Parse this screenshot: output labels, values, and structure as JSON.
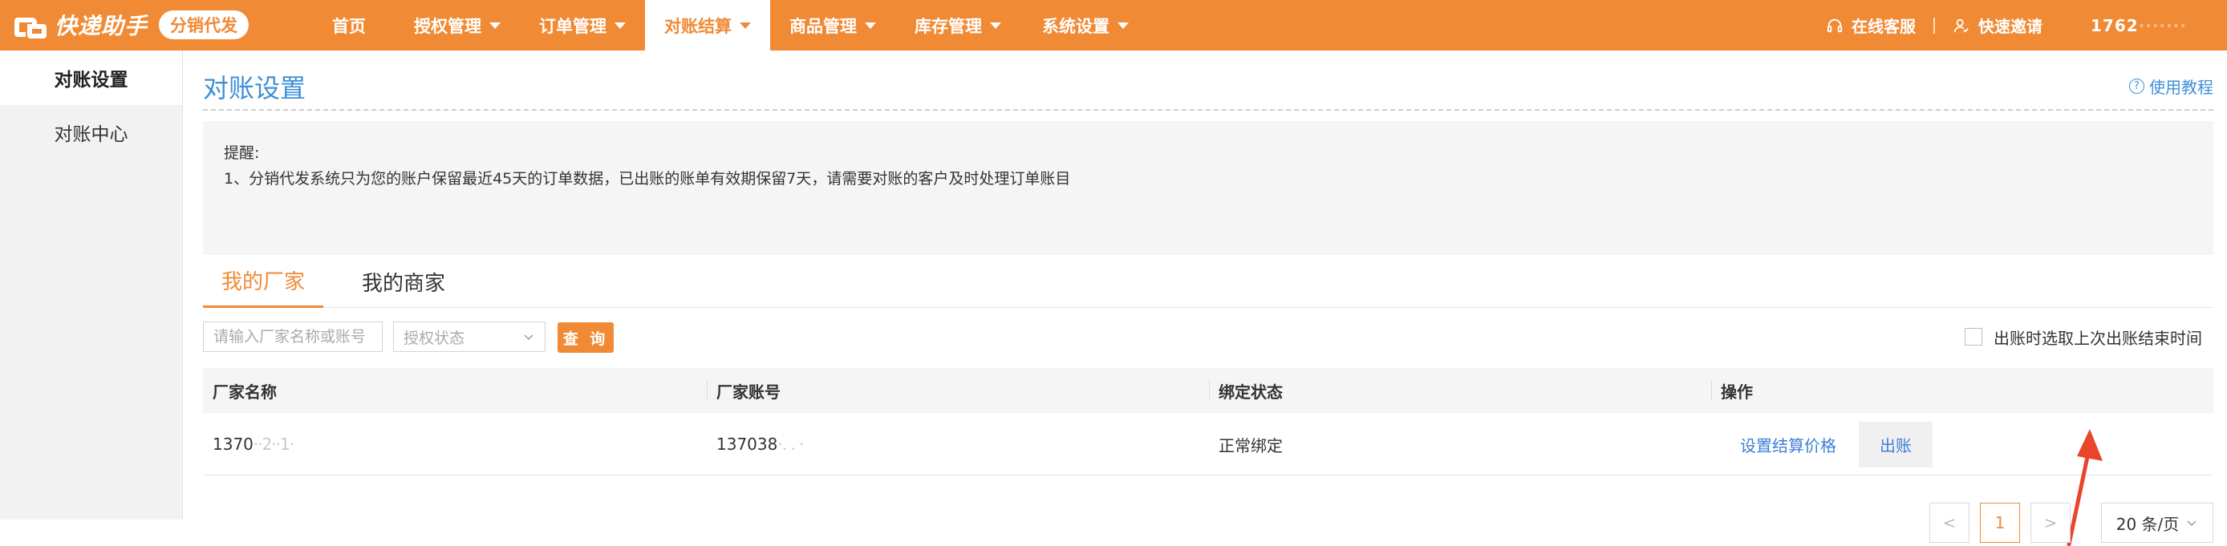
{
  "header": {
    "logo_text": "快递助手",
    "badge": "分销代发",
    "nav": [
      {
        "label": "首页",
        "has_caret": false,
        "active": false
      },
      {
        "label": "授权管理",
        "has_caret": true,
        "active": false
      },
      {
        "label": "订单管理",
        "has_caret": true,
        "active": false
      },
      {
        "label": "对账结算",
        "has_caret": true,
        "active": true
      },
      {
        "label": "商品管理",
        "has_caret": true,
        "active": false
      },
      {
        "label": "库存管理",
        "has_caret": true,
        "active": false
      },
      {
        "label": "系统设置",
        "has_caret": true,
        "active": false
      }
    ],
    "online_service": "在线客服",
    "quick_invite": "快速邀请",
    "phone_visible": "1762",
    "phone_masked": "·······"
  },
  "sidebar": {
    "items": [
      {
        "label": "对账设置",
        "active": true
      },
      {
        "label": "对账中心",
        "active": false
      }
    ]
  },
  "main": {
    "title": "对账设置",
    "help_link": "使用教程",
    "notice": {
      "heading": "提醒:",
      "line1": "1、分销代发系统只为您的账户保留最近45天的订单数据，已出账的账单有效期保留7天，请需要对账的客户及时处理订单账目"
    },
    "tabs": [
      {
        "label": "我的厂家",
        "active": true
      },
      {
        "label": "我的商家",
        "active": false
      }
    ],
    "filter": {
      "search_placeholder": "请输入厂家名称或账号",
      "status_placeholder": "授权状态",
      "query_label": "查 询",
      "checkbox_label": "出账时选取上次出账结束时间"
    },
    "table": {
      "columns": [
        "厂家名称",
        "厂家账号",
        "绑定状态",
        "操作"
      ],
      "rows": [
        {
          "name_visible": "1370",
          "name_masked": "··2··1·",
          "account_visible": "137038",
          "account_masked": "·. . ·",
          "status": "正常绑定",
          "op_set_price": "设置结算价格",
          "op_bill": "出账"
        }
      ]
    },
    "pager": {
      "prev": "<",
      "page": "1",
      "next": ">",
      "size": "20 条/页"
    }
  },
  "colors": {
    "brand": "#f08a35",
    "link": "#3d7fd6",
    "title": "#3d8fd6",
    "arrow": "#e8452c"
  }
}
